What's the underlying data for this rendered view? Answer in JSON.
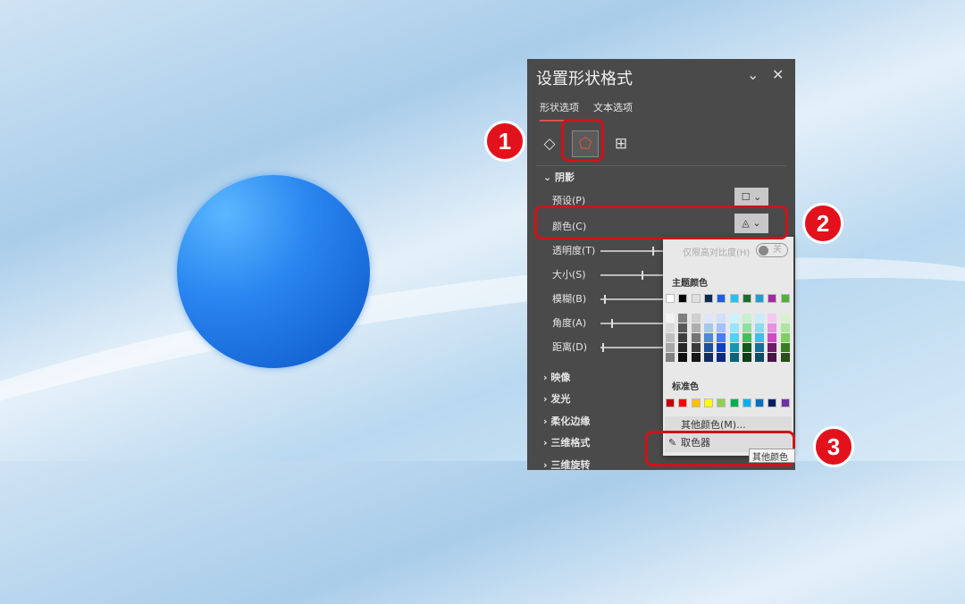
{
  "panel": {
    "title": "设置形状格式",
    "tabs": [
      "形状选项",
      "文本选项"
    ],
    "section": "阴影",
    "preset": "预设(P)",
    "color": "颜色(C)",
    "sliders": [
      "透明度(T)",
      "大小(S)",
      "模糊(B)",
      "角度(A)",
      "距离(D)"
    ],
    "slider_values": [
      0.9,
      0.65,
      0.05,
      0.2,
      0.02
    ],
    "collapsed": [
      "映像",
      "发光",
      "柔化边缘",
      "三维格式",
      "三维旋转"
    ]
  },
  "popup": {
    "contrast_label": "仅限高对比度(H)",
    "toggle": "关",
    "theme_label": "主题颜色",
    "standard_label": "标准色",
    "more": "其他颜色(M)...",
    "eyedropper": "取色器",
    "tooltip": "其他颜色",
    "theme": [
      "#ffffff",
      "#000000",
      "#e7e6e6",
      "#0e2841",
      "#156082",
      "#0f9ed5",
      "#196b24",
      "#0f9ed5",
      "#a02b93",
      "#4ea72e"
    ],
    "theme_top": [
      "#ffffff",
      "#000000",
      "#e0e0e0",
      "#0d2a50",
      "#1a5de8",
      "#22c3f0",
      "#1b6e2a",
      "#1f9fd0",
      "#a32aa0",
      "#4fb03a"
    ],
    "shades": [
      [
        "#f2f2f2",
        "#d9d9d9",
        "#bfbfbf",
        "#a6a6a6",
        "#808080"
      ],
      [
        "#7f7f7f",
        "#595959",
        "#3f3f3f",
        "#262626",
        "#0d0d0d"
      ],
      [
        "#d0d0d0",
        "#afafaf",
        "#757575",
        "#3a3a3a",
        "#161616"
      ],
      [
        "#dce6f7",
        "#a9c6ef",
        "#4f88d8",
        "#1e4f9a",
        "#122e5e"
      ],
      [
        "#d2deff",
        "#a6bfff",
        "#4a7cf2",
        "#0f3fc2",
        "#0a2a80"
      ],
      [
        "#caf3fb",
        "#95e7f7",
        "#4fd2ef",
        "#1496b6",
        "#0d6478"
      ],
      [
        "#c7efd0",
        "#90e0a1",
        "#3ec05c",
        "#135c20",
        "#0c3d15"
      ],
      [
        "#c8ecf8",
        "#92d8f2",
        "#4ab8e6",
        "#137099",
        "#0c4b66"
      ],
      [
        "#f4c8ef",
        "#e891df",
        "#cf4bc2",
        "#6e1d65",
        "#491343"
      ],
      [
        "#d8f2cf",
        "#b0e5a0",
        "#7dcf62",
        "#3a7d22",
        "#274f17"
      ]
    ],
    "standard": [
      "#c00000",
      "#ff0000",
      "#ffc000",
      "#ffff00",
      "#92d050",
      "#00b050",
      "#00b0f0",
      "#0070c0",
      "#002060",
      "#7030a0"
    ]
  },
  "badges": [
    "1",
    "2",
    "3"
  ],
  "icons": [
    "fill-line-icon",
    "effects-icon",
    "size-properties-icon"
  ]
}
